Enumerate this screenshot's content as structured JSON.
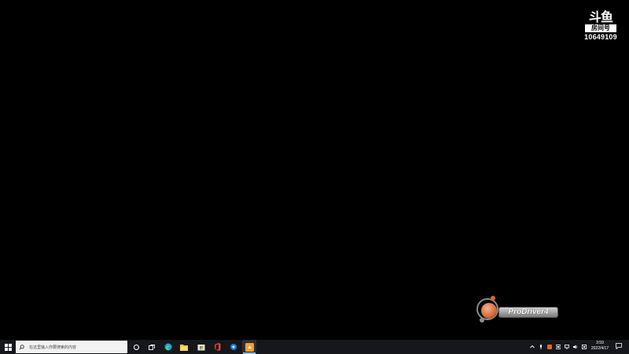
{
  "watermark": {
    "logo": "斗鱼",
    "label": "房间号",
    "room_number": "10649109"
  },
  "widget": {
    "label": "ProDriver4"
  },
  "taskbar": {
    "search_placeholder": "在这里输入你要搜索的内容",
    "clock": {
      "time": "3:59",
      "date": "2022/4/17"
    },
    "apps": [
      {
        "name": "edge-icon"
      },
      {
        "name": "file-explorer-icon"
      },
      {
        "name": "store-icon"
      },
      {
        "name": "office-icon"
      },
      {
        "name": "control-app-icon"
      },
      {
        "name": "orange-app-icon"
      }
    ],
    "tray_icons": [
      "chevron-up-icon",
      "microphone-icon",
      "orange-tray-icon",
      "input-method-icon",
      "network-icon",
      "volume-icon",
      "keyboard-icon"
    ]
  },
  "colors": {
    "desktop_background": "#000000",
    "taskbar_background": "#15171b",
    "search_background": "#f2f2f2",
    "accent": "#7fb3e0",
    "widget_orange": "#d26a3a"
  }
}
